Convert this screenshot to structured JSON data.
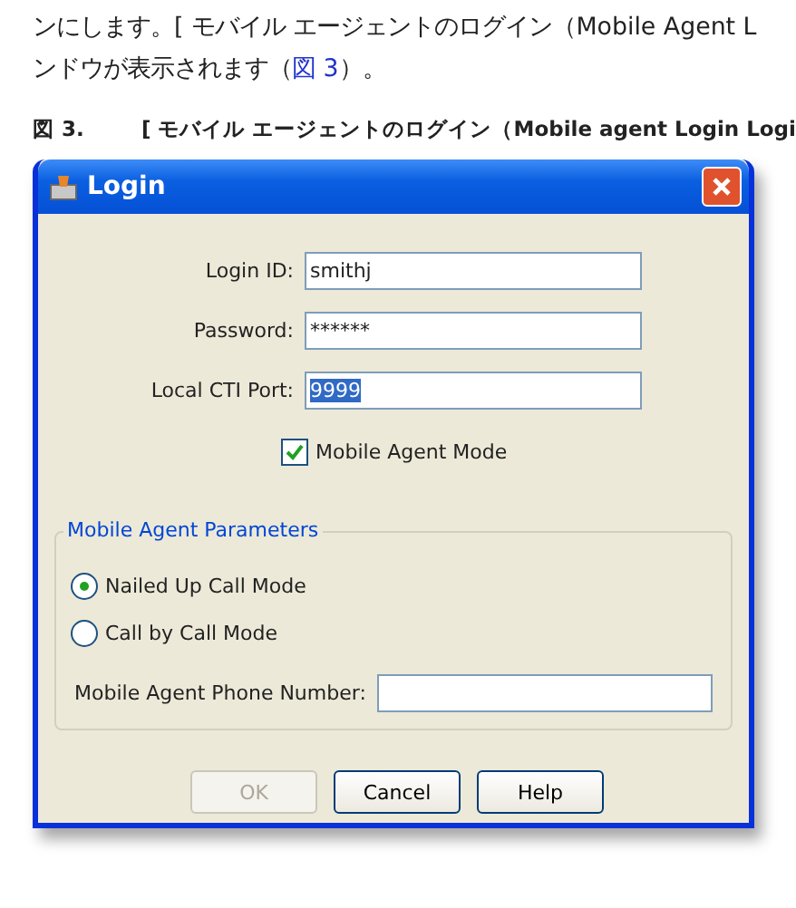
{
  "intro": {
    "line_1": "ンにします。[ モバイル エージェントのログイン（Mobile Agent L",
    "line_2_before": "ンドウが表示されます（",
    "line_2_link": "図 3",
    "line_2_after": "）。"
  },
  "figure_caption": {
    "number": "図 3.",
    "title": "[ モバイル エージェントのログイン（Mobile agent Login Logi"
  },
  "window": {
    "title": "Login"
  },
  "fields": [
    {
      "label": "Login ID:",
      "value": "smithj",
      "selected_text": false
    },
    {
      "label": "Password:",
      "value": "******",
      "selected_text": false
    },
    {
      "label": "Local CTI Port:",
      "value": "9999",
      "selected_text": true
    }
  ],
  "mobile_agent_mode": {
    "label": "Mobile Agent Mode",
    "checked": true
  },
  "group": {
    "title": "Mobile Agent Parameters",
    "radios": [
      {
        "label": "Nailed Up Call Mode",
        "selected": true
      },
      {
        "label": "Call by Call Mode",
        "selected": false
      }
    ],
    "phone_field": {
      "label": "Mobile Agent Phone Number:"
    }
  },
  "buttons": [
    {
      "label": "OK",
      "disabled": true
    },
    {
      "label": "Cancel",
      "disabled": false
    },
    {
      "label": "Help",
      "disabled": false
    }
  ]
}
